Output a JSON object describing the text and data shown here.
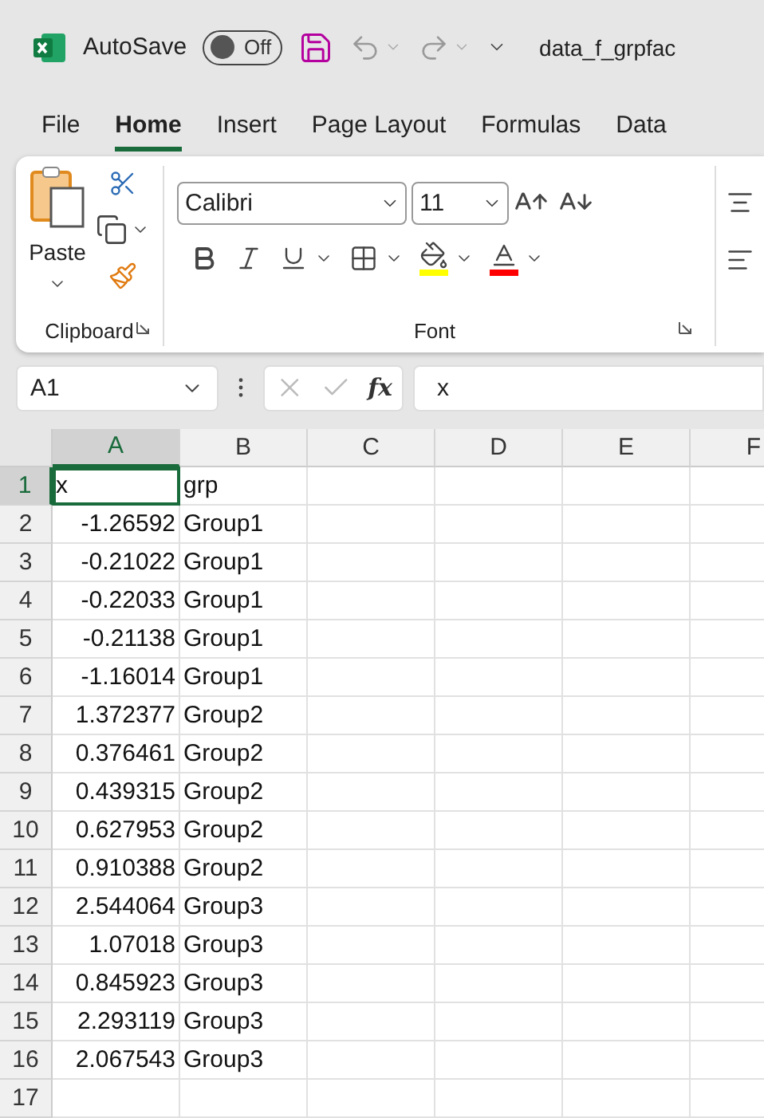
{
  "title_bar": {
    "autosave_label": "AutoSave",
    "autosave": {
      "on": false,
      "label": "Off"
    },
    "file_name": "data_f_grpfac"
  },
  "tabs": [
    {
      "label": "File",
      "selected": false
    },
    {
      "label": "Home",
      "selected": true
    },
    {
      "label": "Insert",
      "selected": false
    },
    {
      "label": "Page Layout",
      "selected": false
    },
    {
      "label": "Formulas",
      "selected": false
    },
    {
      "label": "Data",
      "selected": false
    }
  ],
  "ribbon": {
    "clipboard": {
      "paste_label": "Paste",
      "group_label": "Clipboard"
    },
    "font": {
      "font_name": "Calibri",
      "font_size": "11",
      "group_label": "Font"
    }
  },
  "formula_bar": {
    "name_box": "A1",
    "function_label": "fx",
    "value": "x"
  },
  "grid": {
    "columns": [
      {
        "label": "A",
        "selected": true
      },
      {
        "label": "B",
        "selected": false
      },
      {
        "label": "C",
        "selected": false
      },
      {
        "label": "D",
        "selected": false
      },
      {
        "label": "E",
        "selected": false
      },
      {
        "label": "F",
        "selected": false
      }
    ],
    "rows": [
      {
        "header": "1",
        "selected": true,
        "cells": [
          {
            "text": "x",
            "kind": "text"
          },
          {
            "text": "grp",
            "kind": "text"
          }
        ]
      },
      {
        "header": "2",
        "selected": false,
        "cells": [
          {
            "text": "-1.26592",
            "kind": "number"
          },
          {
            "text": "Group1",
            "kind": "text"
          }
        ]
      },
      {
        "header": "3",
        "selected": false,
        "cells": [
          {
            "text": "-0.21022",
            "kind": "number"
          },
          {
            "text": "Group1",
            "kind": "text"
          }
        ]
      },
      {
        "header": "4",
        "selected": false,
        "cells": [
          {
            "text": "-0.22033",
            "kind": "number"
          },
          {
            "text": "Group1",
            "kind": "text"
          }
        ]
      },
      {
        "header": "5",
        "selected": false,
        "cells": [
          {
            "text": "-0.21138",
            "kind": "number"
          },
          {
            "text": "Group1",
            "kind": "text"
          }
        ]
      },
      {
        "header": "6",
        "selected": false,
        "cells": [
          {
            "text": "-1.16014",
            "kind": "number"
          },
          {
            "text": "Group1",
            "kind": "text"
          }
        ]
      },
      {
        "header": "7",
        "selected": false,
        "cells": [
          {
            "text": "1.372377",
            "kind": "number"
          },
          {
            "text": "Group2",
            "kind": "text"
          }
        ]
      },
      {
        "header": "8",
        "selected": false,
        "cells": [
          {
            "text": "0.376461",
            "kind": "number"
          },
          {
            "text": "Group2",
            "kind": "text"
          }
        ]
      },
      {
        "header": "9",
        "selected": false,
        "cells": [
          {
            "text": "0.439315",
            "kind": "number"
          },
          {
            "text": "Group2",
            "kind": "text"
          }
        ]
      },
      {
        "header": "10",
        "selected": false,
        "cells": [
          {
            "text": "0.627953",
            "kind": "number"
          },
          {
            "text": "Group2",
            "kind": "text"
          }
        ]
      },
      {
        "header": "11",
        "selected": false,
        "cells": [
          {
            "text": "0.910388",
            "kind": "number"
          },
          {
            "text": "Group2",
            "kind": "text"
          }
        ]
      },
      {
        "header": "12",
        "selected": false,
        "cells": [
          {
            "text": "2.544064",
            "kind": "number"
          },
          {
            "text": "Group3",
            "kind": "text"
          }
        ]
      },
      {
        "header": "13",
        "selected": false,
        "cells": [
          {
            "text": "1.07018",
            "kind": "number"
          },
          {
            "text": "Group3",
            "kind": "text"
          }
        ]
      },
      {
        "header": "14",
        "selected": false,
        "cells": [
          {
            "text": "0.845923",
            "kind": "number"
          },
          {
            "text": "Group3",
            "kind": "text"
          }
        ]
      },
      {
        "header": "15",
        "selected": false,
        "cells": [
          {
            "text": "2.293119",
            "kind": "number"
          },
          {
            "text": "Group3",
            "kind": "text"
          }
        ]
      },
      {
        "header": "16",
        "selected": false,
        "cells": [
          {
            "text": "2.067543",
            "kind": "number"
          },
          {
            "text": "Group3",
            "kind": "text"
          }
        ]
      },
      {
        "header": "17",
        "selected": false,
        "cells": []
      }
    ]
  }
}
